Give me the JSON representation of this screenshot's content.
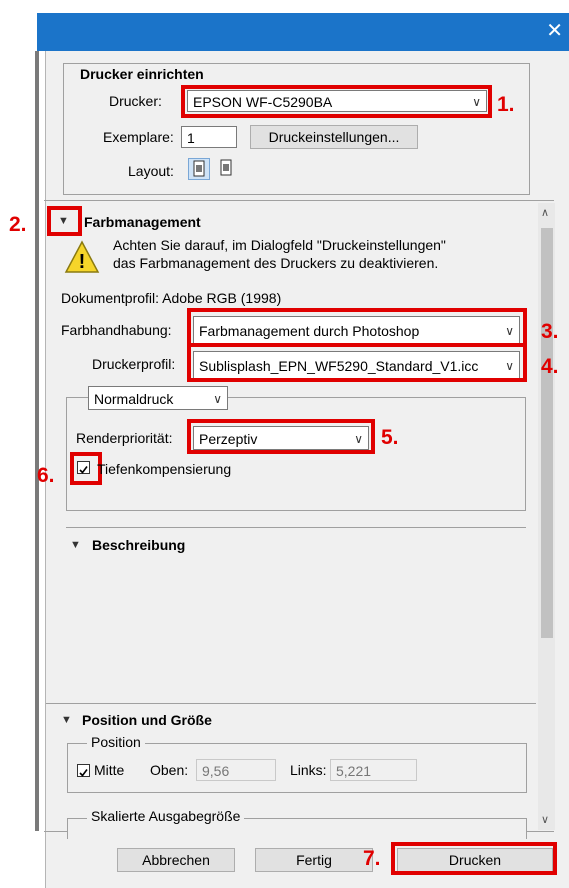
{
  "window": {
    "close_glyph": "✕"
  },
  "printer_setup": {
    "title": "Drucker einrichten",
    "printer_label": "Drucker:",
    "printer_value": "EPSON WF-C5290BA",
    "copies_label": "Exemplare:",
    "copies_value": "1",
    "print_settings_button": "Druckeinstellungen...",
    "layout_label": "Layout:"
  },
  "color_management": {
    "title": "Farbmanagement",
    "warning_line1": "Achten Sie darauf, im Dialogfeld \"Druckeinstellungen\"",
    "warning_line2": "das Farbmanagement des Druckers zu deaktivieren.",
    "document_profile": "Dokumentprofil: Adobe RGB (1998)",
    "color_handling_label": "Farbhandhabung:",
    "color_handling_value": "Farbmanagement durch Photoshop",
    "printer_profile_label": "Druckerprofil:",
    "printer_profile_value": "Sublisplash_EPN_WF5290_Standard_V1.icc",
    "print_mode_value": "Normaldruck",
    "rendering_intent_label": "Renderpriorität:",
    "rendering_intent_value": "Perzeptiv",
    "black_point_label": "Tiefenkompensierung",
    "black_point_checked": true
  },
  "description": {
    "title": "Beschreibung"
  },
  "position_size": {
    "title": "Position und Größe",
    "position_group": "Position",
    "center_label": "Mitte",
    "center_checked": true,
    "top_label": "Oben:",
    "top_value": "9,56",
    "left_label": "Links:",
    "left_value": "5,221",
    "scaled_output": "Skalierte Ausgabegröße"
  },
  "footer": {
    "cancel": "Abbrechen",
    "done": "Fertig",
    "print": "Drucken"
  },
  "annotations": {
    "n1": "1.",
    "n2": "2.",
    "n3": "3.",
    "n4": "4.",
    "n5": "5.",
    "n6": "6.",
    "n7": "7."
  },
  "colors": {
    "titlebar": "#1b74c9",
    "annotation_red": "#e00000",
    "dialog_bg": "#f0f0f0"
  }
}
